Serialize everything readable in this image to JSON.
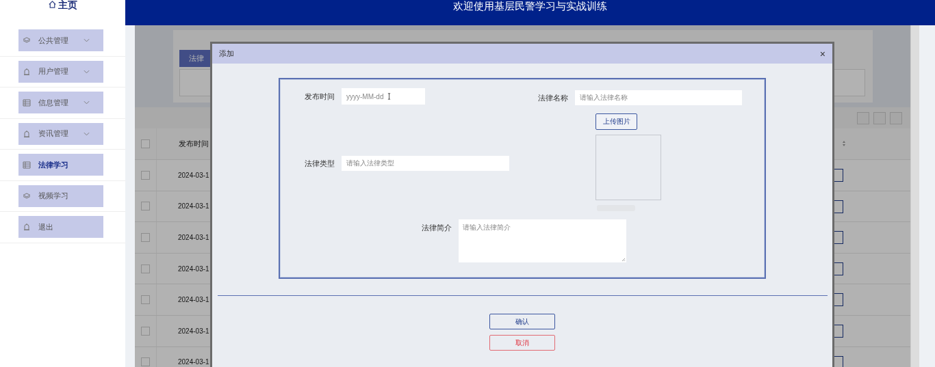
{
  "header": {
    "home": "主页",
    "title": "欢迎使用基层民警学习与实战训练"
  },
  "sidebar": {
    "items": [
      {
        "label": "公共管理",
        "kind": "layers",
        "expandable": true,
        "selected": false
      },
      {
        "label": "用户管理",
        "kind": "bell",
        "expandable": true,
        "selected": false
      },
      {
        "label": "信息管理",
        "kind": "list",
        "expandable": true,
        "selected": false
      },
      {
        "label": "资讯管理",
        "kind": "bell",
        "expandable": true,
        "selected": false
      },
      {
        "label": "法律学习",
        "kind": "list",
        "expandable": false,
        "selected": true
      },
      {
        "label": "视频学习",
        "kind": "layers",
        "expandable": false,
        "selected": false
      },
      {
        "label": "退出",
        "kind": "bell",
        "expandable": false,
        "selected": false
      }
    ]
  },
  "page": {
    "search_label": "法律",
    "table": {
      "all_checked": false,
      "columns": [
        "发布时间"
      ],
      "rows": [
        {
          "date": "2024-03-1",
          "checked": false
        },
        {
          "date": "2024-03-1",
          "checked": false
        },
        {
          "date": "2024-03-1",
          "checked": false
        },
        {
          "date": "2024-03-1",
          "checked": false
        },
        {
          "date": "2024-03-1",
          "checked": false
        },
        {
          "date": "2024-03-1",
          "checked": false
        },
        {
          "date": "2024-03-1",
          "checked": false
        }
      ]
    }
  },
  "dialog": {
    "title": "添加",
    "close": "×",
    "date_field": {
      "label": "发布时间",
      "placeholder": "yyyy-MM-dd"
    },
    "name_field": {
      "label": "法律名称",
      "placeholder": "请输入法律名称"
    },
    "upload_button": "上传图片",
    "type_field": {
      "label": "法律类型",
      "placeholder": "请输入法律类型"
    },
    "intro_field": {
      "label": "法律简介",
      "placeholder": "请输入法律简介"
    },
    "confirm": "确认",
    "cancel": "取消"
  }
}
